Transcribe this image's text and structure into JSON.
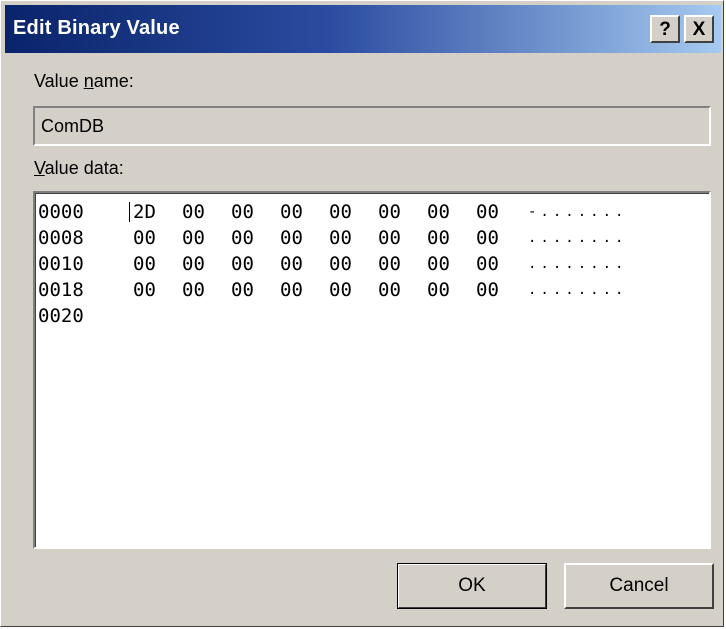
{
  "window": {
    "title": "Edit Binary Value",
    "help_button": "?",
    "close_button": "X"
  },
  "value_name": {
    "label_prefix": "Value ",
    "label_accel": "n",
    "label_suffix": "ame:",
    "value": "ComDB"
  },
  "value_data": {
    "label_accel": "V",
    "label_suffix": "alue data:",
    "rows": [
      {
        "address": "0000",
        "bytes": [
          "2D",
          "00",
          "00",
          "00",
          "00",
          "00",
          "00",
          "00"
        ],
        "ascii": "-......."
      },
      {
        "address": "0008",
        "bytes": [
          "00",
          "00",
          "00",
          "00",
          "00",
          "00",
          "00",
          "00"
        ],
        "ascii": "........"
      },
      {
        "address": "0010",
        "bytes": [
          "00",
          "00",
          "00",
          "00",
          "00",
          "00",
          "00",
          "00"
        ],
        "ascii": "........"
      },
      {
        "address": "0018",
        "bytes": [
          "00",
          "00",
          "00",
          "00",
          "00",
          "00",
          "00",
          "00"
        ],
        "ascii": "........"
      },
      {
        "address": "0020",
        "bytes": [],
        "ascii": ""
      }
    ]
  },
  "buttons": {
    "ok": "OK",
    "cancel": "Cancel"
  },
  "colors": {
    "title_bar_start": "#0a246a",
    "title_bar_end": "#a6caf0",
    "dialog_face": "#d4d0c8"
  }
}
